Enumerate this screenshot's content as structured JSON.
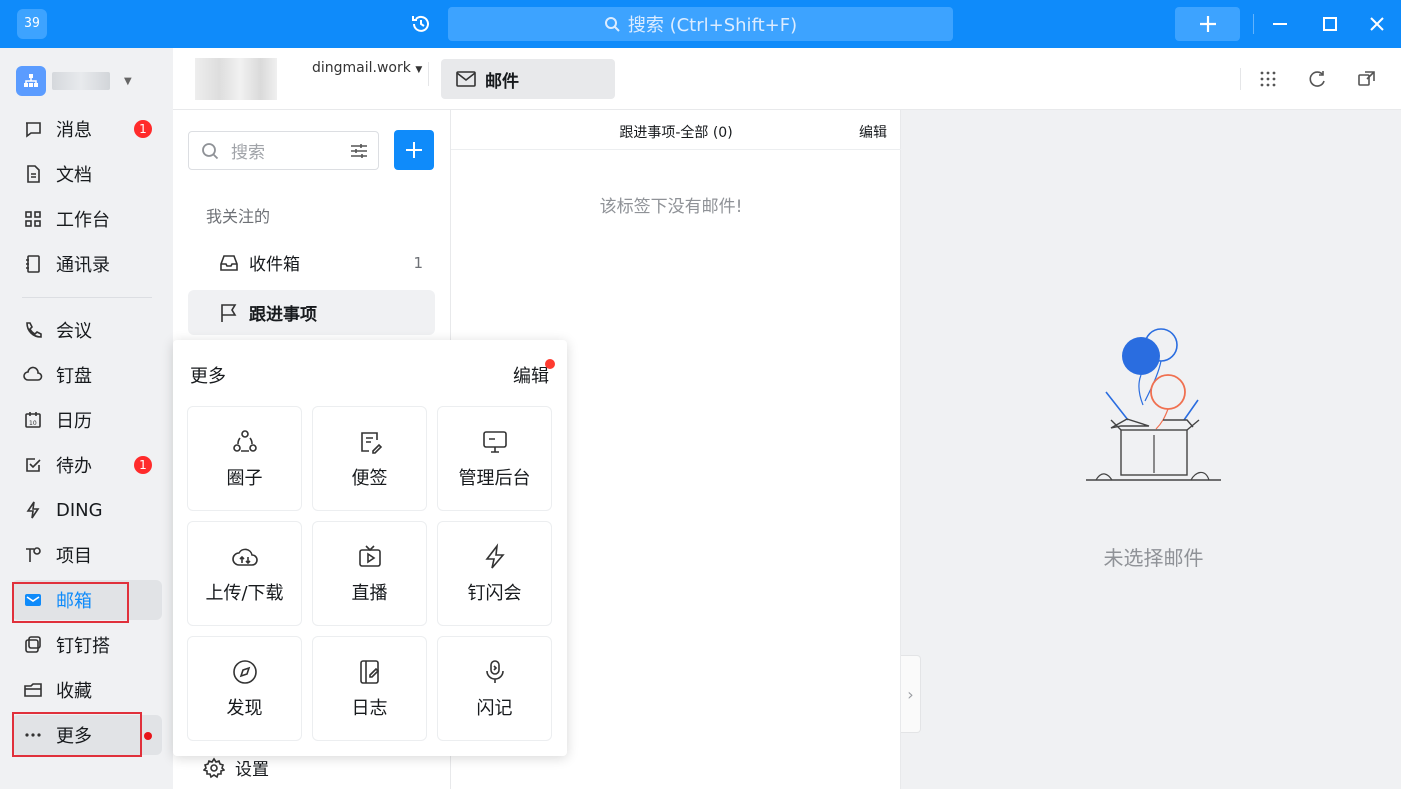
{
  "titlebar": {
    "badge": "39",
    "search_placeholder": "搜索 (Ctrl+Shift+F)"
  },
  "leftnav": {
    "items": [
      {
        "label": "消息",
        "badge": "1"
      },
      {
        "label": "文档"
      },
      {
        "label": "工作台"
      },
      {
        "label": "通讯录"
      },
      {
        "label": "会议"
      },
      {
        "label": "钉盘"
      },
      {
        "label": "日历"
      },
      {
        "label": "待办",
        "badge": "1"
      },
      {
        "label": "DING"
      },
      {
        "label": "项目"
      },
      {
        "label": "邮箱",
        "active": true
      },
      {
        "label": "钉钉搭"
      },
      {
        "label": "收藏"
      },
      {
        "label": "更多"
      }
    ]
  },
  "topbar": {
    "domain": "dingmail.work",
    "tab_label": "邮件"
  },
  "folders": {
    "search_placeholder": "搜索",
    "section_heading": "我关注的",
    "items": [
      {
        "label": "收件箱",
        "count": "1"
      },
      {
        "label": "跟进事项",
        "selected": true
      }
    ],
    "settings_label": "设置"
  },
  "list": {
    "title": "跟进事项-全部 (0)",
    "edit_label": "编辑",
    "empty_message": "该标签下没有邮件!"
  },
  "detail": {
    "no_selection": "未选择邮件"
  },
  "more_popup": {
    "title": "更多",
    "edit_label": "编辑",
    "tiles": [
      {
        "label": "圈子",
        "icon": "circle-group-icon"
      },
      {
        "label": "便签",
        "icon": "note-icon"
      },
      {
        "label": "管理后台",
        "icon": "monitor-icon"
      },
      {
        "label": "上传/下载",
        "icon": "cloud-transfer-icon"
      },
      {
        "label": "直播",
        "icon": "live-tv-icon"
      },
      {
        "label": "钉闪会",
        "icon": "lightning-icon"
      },
      {
        "label": "发现",
        "icon": "compass-icon"
      },
      {
        "label": "日志",
        "icon": "journal-icon"
      },
      {
        "label": "闪记",
        "icon": "mic-note-icon"
      }
    ]
  },
  "colors": {
    "brand": "#0f8bfa",
    "badge_red": "#ff2b2b",
    "highlight_outline": "#e0303b"
  }
}
